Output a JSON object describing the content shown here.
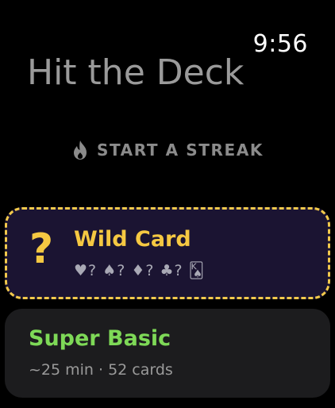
{
  "status": {
    "time": "9:56"
  },
  "header": {
    "title": "Hit the Deck"
  },
  "streak": {
    "icon": "flame-icon",
    "label": "START A STREAK"
  },
  "decks": [
    {
      "icon": "question-mark-icon",
      "icon_glyph": "?",
      "title": "Wild Card",
      "subtitle": "♥? ♠? ♦? ♣? 🂮",
      "color": "#f5c842",
      "border_color": "#f2c94c",
      "background": "#1b1432"
    },
    {
      "title": "Super Basic",
      "subtitle": "~25 min · 52 cards",
      "color": "#7ed957",
      "background": "#1c1c1e"
    }
  ]
}
